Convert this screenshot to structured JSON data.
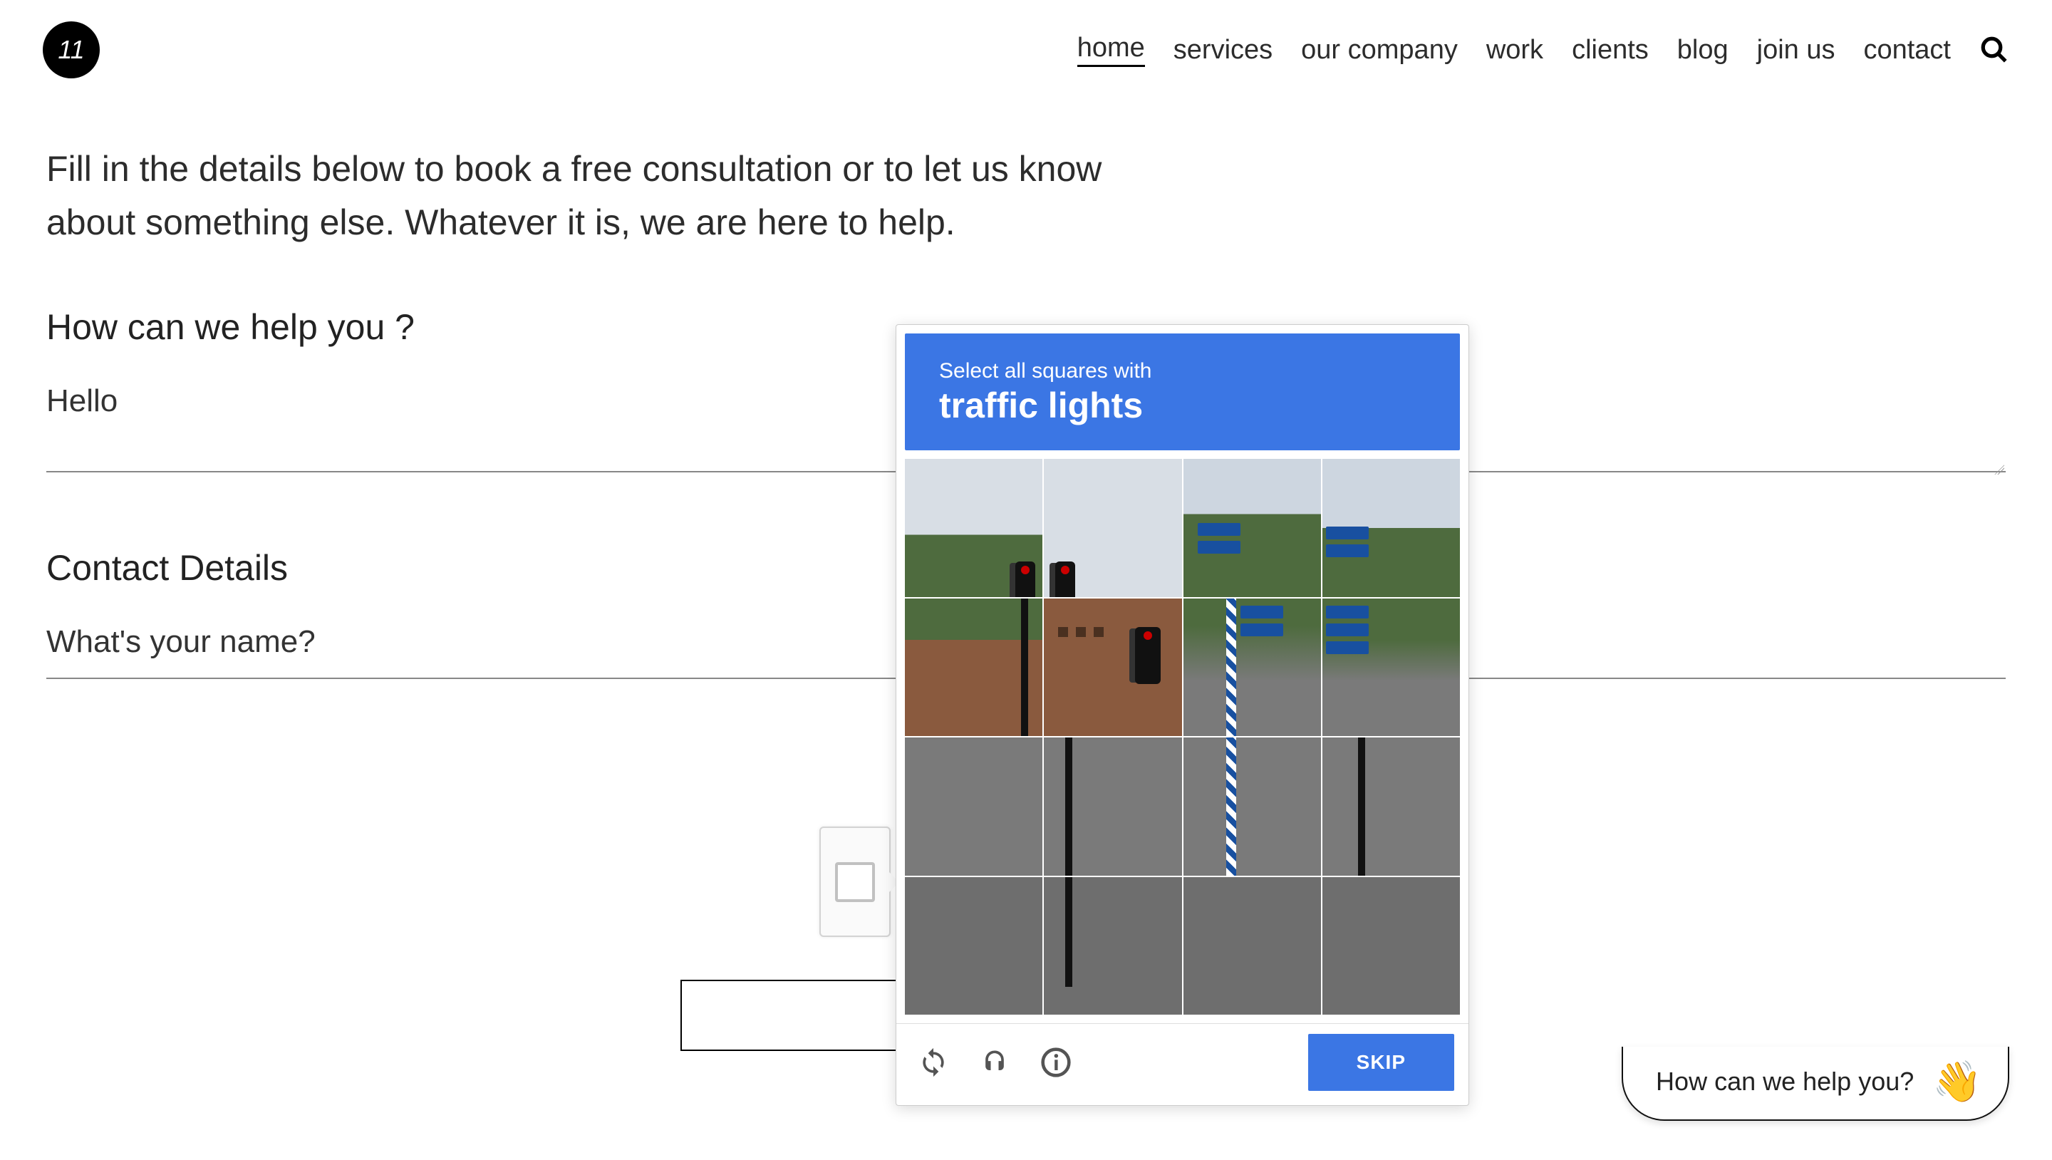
{
  "logo": {
    "text": "11"
  },
  "nav": {
    "items": [
      {
        "label": "home",
        "active": true
      },
      {
        "label": "services",
        "active": false
      },
      {
        "label": "our company",
        "active": false
      },
      {
        "label": "work",
        "active": false
      },
      {
        "label": "clients",
        "active": false
      },
      {
        "label": "blog",
        "active": false
      },
      {
        "label": "join us",
        "active": false
      },
      {
        "label": "contact",
        "active": false
      }
    ]
  },
  "form": {
    "intro": "Fill in the details below to book a free consultation or to let us know about something else. Whatever it is, we are here to help.",
    "help_title": "How can we help you ?",
    "message_value": "Hello",
    "message_placeholder": "",
    "contact_title": "Contact Details",
    "name_placeholder": "What's your name?"
  },
  "recaptcha": {
    "instruction": "Select all squares with",
    "subject": "traffic lights",
    "skip_label": "SKIP",
    "grid_size": 4
  },
  "chat": {
    "text": "How can we help you?",
    "emoji": "👋"
  }
}
